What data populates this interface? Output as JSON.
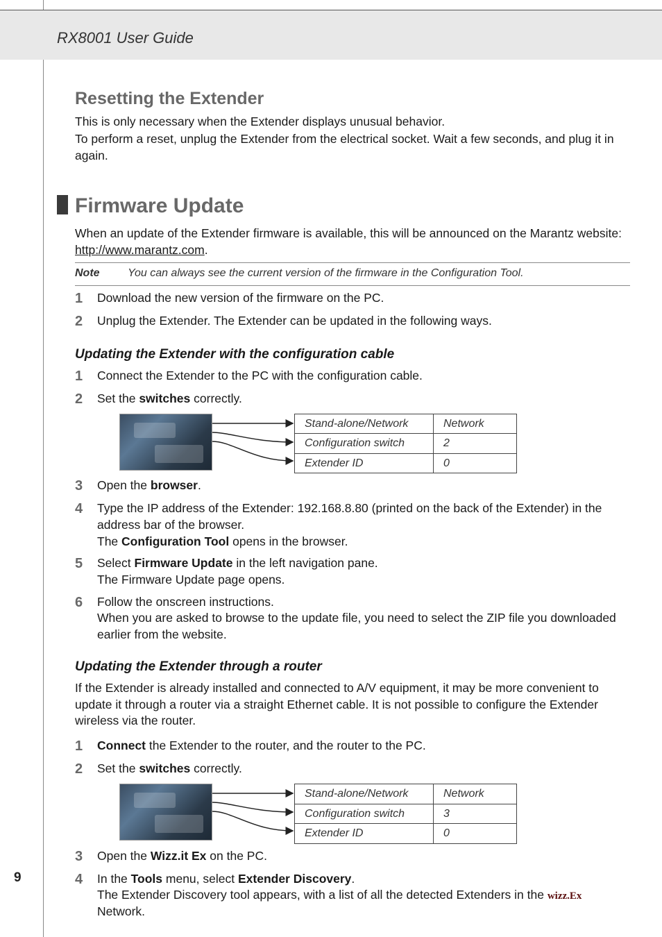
{
  "header": {
    "guide_title": "RX8001 User Guide"
  },
  "page_number": "9",
  "resetting": {
    "heading": "Resetting the Extender",
    "p1": "This is only necessary when the Extender displays unusual behavior.",
    "p2": "To perform a reset, unplug the Extender from the electrical socket. Wait a few seconds, and plug it in again."
  },
  "firmware": {
    "heading": "Firmware Update",
    "intro_pre": "When an update of the Extender firmware is available, this will be announced on the Marantz website: ",
    "intro_link": "http://www.marantz.com",
    "intro_post": ".",
    "note_label": "Note",
    "note_text": "You can always see the current version of the firmware in the Configuration Tool.",
    "step1": "Download the new version of the firmware on the PC.",
    "step2": "Unplug the Extender. The Extender can be updated in the following ways."
  },
  "cable": {
    "heading": "Updating the Extender with the configuration cable",
    "step1": "Connect the Extender to the PC with the configuration cable.",
    "step2_pre": "Set the ",
    "step2_b": "switches",
    "step2_post": " correctly.",
    "table": {
      "r1": {
        "k": "Stand-alone/Network",
        "v": "Network"
      },
      "r2": {
        "k": "Configuration switch",
        "v": "2"
      },
      "r3": {
        "k": "Extender ID",
        "v": "0"
      }
    },
    "step3_pre": "Open the ",
    "step3_b": "browser",
    "step3_post": ".",
    "step4_l1": "Type the IP address of the Extender: 192.168.8.80 (printed on the back of the Extender) in the address bar of the browser.",
    "step4_l2_pre": "The ",
    "step4_l2_b": "Configuration Tool",
    "step4_l2_post": " opens in the browser.",
    "step5_l1_pre": "Select ",
    "step5_l1_b": "Firmware Update",
    "step5_l1_post": " in the left navigation pane.",
    "step5_l2": "The Firmware Update page opens.",
    "step6_l1": "Follow the onscreen instructions.",
    "step6_l2": "When you are asked to browse to the update file, you need to select the ZIP file you downloaded earlier from the website."
  },
  "router": {
    "heading": "Updating the Extender through a router",
    "intro": "If the Extender is already installed and connected to A/V equipment, it may be more convenient to update it through a router via a straight Ethernet cable. It is not possible to configure the Extender wireless via the router.",
    "step1_b": "Connect",
    "step1_post": " the Extender to the router, and the router to the PC.",
    "step2_pre": "Set the ",
    "step2_b": "switches",
    "step2_post": " correctly.",
    "table": {
      "r1": {
        "k": "Stand-alone/Network",
        "v": "Network"
      },
      "r2": {
        "k": "Configuration switch",
        "v": "3"
      },
      "r3": {
        "k": "Extender ID",
        "v": "0"
      }
    },
    "step3_pre": "Open the ",
    "step3_b": "Wizz.it Ex",
    "step3_post": " on the PC.",
    "step4_l1_pre": "In the ",
    "step4_l1_b1": "Tools",
    "step4_l1_mid": " menu, select ",
    "step4_l1_b2": "Extender Discovery",
    "step4_l1_post": ".",
    "step4_l2_pre": "The Extender Discovery tool appears, with a list of all the detected Extenders in the ",
    "step4_l2_post": " Network.",
    "logo_text": "wizz.Ex"
  }
}
